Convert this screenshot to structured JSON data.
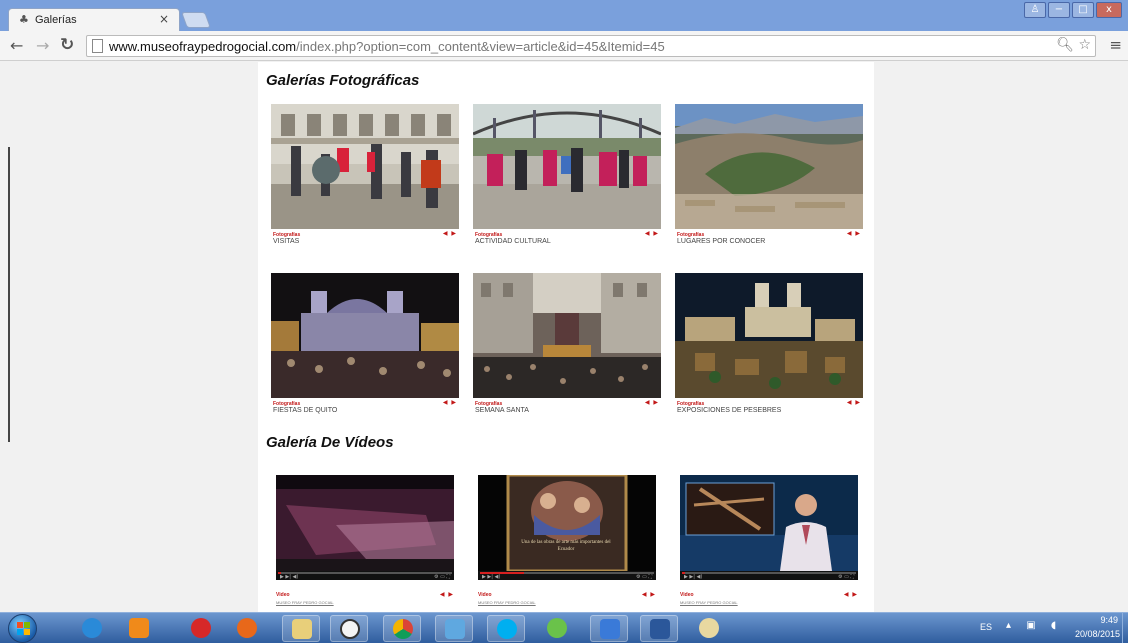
{
  "browser": {
    "tab_title": "Galerías",
    "tab_close": "×",
    "url_host": "www.museofraypedrogocial.com",
    "url_path": "/index.php?option=com_content&view=article&id=45&Itemid=45",
    "window_controls": [
      "−",
      "□",
      "x"
    ]
  },
  "page": {
    "photo_section_title": "Galerías Fotográficas",
    "video_section_title": "Galería De Vídeos",
    "photo_arrows": "◀ ▶",
    "photo_galleries": [
      {
        "category": "Fotografías",
        "title": "VISITAS"
      },
      {
        "category": "Fotografías",
        "title": "ACTIVIDAD CULTURAL"
      },
      {
        "category": "Fotografías",
        "title": "LUGARES POR CONOCER"
      },
      {
        "category": "Fotografías",
        "title": "FIESTAS DE QUITO"
      },
      {
        "category": "Fotografías",
        "title": "SEMANA SANTA"
      },
      {
        "category": "Fotografías",
        "title": "EXPOSICIONES DE PESEBRES"
      }
    ],
    "videos": [
      {
        "category": "Video",
        "subtitle": "MUSEO FRAY PEDRO GOCIAL",
        "progress": 0.02,
        "overlay": ""
      },
      {
        "category": "Video",
        "subtitle": "MUSEO FRAY PEDRO GOCIAL",
        "progress": 0.25,
        "overlay": "Una de las obras de arte más importantes del Ecuador"
      },
      {
        "category": "Video",
        "subtitle": "MUSEO FRAY PEDRO GOCIAL",
        "progress": 0.02,
        "overlay": ""
      }
    ]
  },
  "taskbar": {
    "language": "ES",
    "time": "9:49",
    "date": "20/08/2015",
    "apps": [
      "internet-explorer",
      "media-player",
      "pin-app",
      "firefox",
      "file-explorer",
      "clock-app",
      "chrome",
      "photo-viewer",
      "skype",
      "group-app",
      "messenger",
      "word",
      "paint"
    ]
  },
  "colors": {
    "accent_red": "#c21818",
    "titlebar": "#7aa0dc",
    "taskbar": "#3a6fb5"
  }
}
